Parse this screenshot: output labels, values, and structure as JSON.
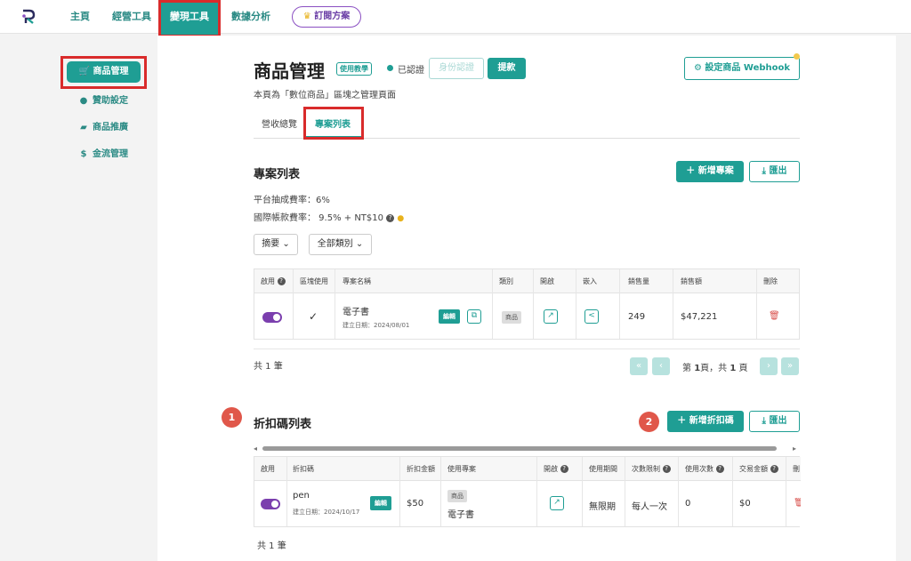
{
  "nav": {
    "items": [
      "主頁",
      "經營工具",
      "變現工具",
      "數據分析"
    ],
    "active": "變現工具",
    "subscribe": "訂閱方案",
    "subscribe_icon": "crown-icon"
  },
  "sidebar": {
    "items": [
      {
        "label": "商品管理",
        "icon": "cart-icon",
        "glyph": "🛒"
      },
      {
        "label": "贊助設定",
        "icon": "coin-icon",
        "glyph": "●"
      },
      {
        "label": "商品推廣",
        "icon": "megaphone-icon",
        "glyph": "▰"
      },
      {
        "label": "金流管理",
        "icon": "dollar-icon",
        "glyph": "$"
      }
    ]
  },
  "header": {
    "title": "商品管理",
    "tutorial_tag": "使用教學",
    "verified": "已認證",
    "identity_btn": "身份認證",
    "withdraw_btn": "提款",
    "webhook_btn": "設定商品 Webhook",
    "subtitle": "本頁為「數位商品」區塊之管理頁面"
  },
  "tabs": [
    "營收總覽",
    "專案列表"
  ],
  "projects": {
    "title": "專案列表",
    "add_btn": "新增專案",
    "export_btn": "匯出",
    "platform_fee": "平台抽成費率：6%",
    "intl_fee": "國際帳款費率： 9.5% + NT$10",
    "filter_summary": "摘要",
    "filter_category": "全部類別",
    "columns": [
      "啟用",
      "區塊使用",
      "專案名稱",
      "類別",
      "開啟",
      "嵌入",
      "銷售量",
      "銷售額",
      "刪除"
    ],
    "row": {
      "name": "電子書",
      "created": "建立日期：2024/08/01",
      "edit": "編輯",
      "category": "商品",
      "sales_qty": "249",
      "sales_amount": "$47,221"
    },
    "total": "共 1 筆",
    "pager_pre": "第",
    "pager_page": "1",
    "pager_mid": "頁，共",
    "pager_total": "1",
    "pager_post": "頁"
  },
  "discounts": {
    "step1": "1",
    "step2": "2",
    "title": "折扣碼列表",
    "add_btn": "新增折扣碼",
    "export_btn": "匯出",
    "columns": [
      "啟用",
      "折扣碼",
      "折扣金額",
      "使用專案",
      "開啟",
      "使用期間",
      "次數限制",
      "使用次數",
      "交易金額",
      "刪"
    ],
    "row": {
      "code": "pen",
      "created": "建立日期：2024/10/17",
      "edit": "編輯",
      "amount": "$50",
      "project_tag": "商品",
      "project": "電子書",
      "period": "無限期",
      "limit": "每人一次",
      "used": "0",
      "trans": "$0"
    },
    "total": "共 1 筆"
  },
  "colors": {
    "primary": "#1f9e94",
    "highlight": "#d92b2b",
    "toggle": "#7b3fae",
    "step": "#e0574a"
  }
}
